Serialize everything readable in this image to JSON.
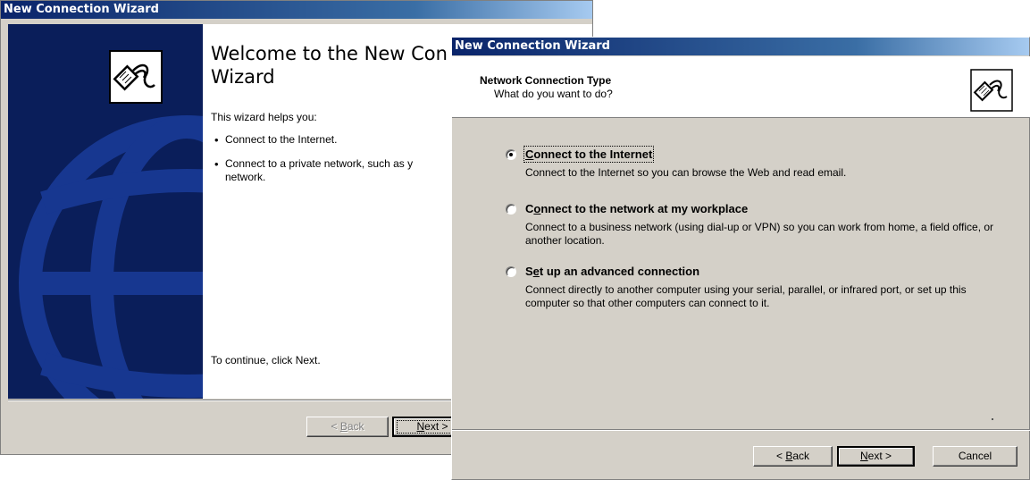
{
  "back_window": {
    "title": "New Connection Wizard",
    "welcome_title": "Welcome to the New Con­nection Wizard",
    "welcome_title_line1": "Welcome to the New Con",
    "welcome_title_line2": "Wizard",
    "intro": "This wizard helps you:",
    "bullets": [
      "Connect to the Internet.",
      "Connect to a private network, such as y",
      "network."
    ],
    "continue_text": "To continue, click Next.",
    "back_label_pre": "< ",
    "back_label_ul": "B",
    "back_label_post": "ack",
    "next_label_ul": "N",
    "next_label_post": "ext >"
  },
  "front_window": {
    "title": "New Connection Wizard",
    "header_title": "Network Connection Type",
    "header_subtitle": "What do you want to do?",
    "options": [
      {
        "label_pre": "",
        "label_ul": "C",
        "label_post": "onnect to the Internet",
        "description": "Connect to the Internet so you can browse the Web and read email.",
        "selected": true
      },
      {
        "label_pre": "C",
        "label_ul": "o",
        "label_post": "nnect to the network at my workplace",
        "description": "Connect to a business network (using dial-up or VPN) so you can work from home, a field office, or another location.",
        "selected": false
      },
      {
        "label_pre": "S",
        "label_ul": "e",
        "label_post": "t up an advanced connection",
        "description": "Connect directly to another computer using your serial, parallel, or infrared port, or set up this computer so that other computers can connect to it.",
        "selected": false
      }
    ],
    "buttons": {
      "back_pre": "< ",
      "back_ul": "B",
      "back_post": "ack",
      "next_ul": "N",
      "next_post": "ext >",
      "cancel": "Cancel"
    }
  },
  "colors": {
    "title_gradient_start": "#0a246a",
    "title_gradient_end": "#a6caf0",
    "dialog_face": "#d4d0c8",
    "side_panel": "#0a1e5a"
  },
  "icons": [
    "network-cable-icon",
    "globe-watermark-icon",
    "radio-button-icon"
  ]
}
